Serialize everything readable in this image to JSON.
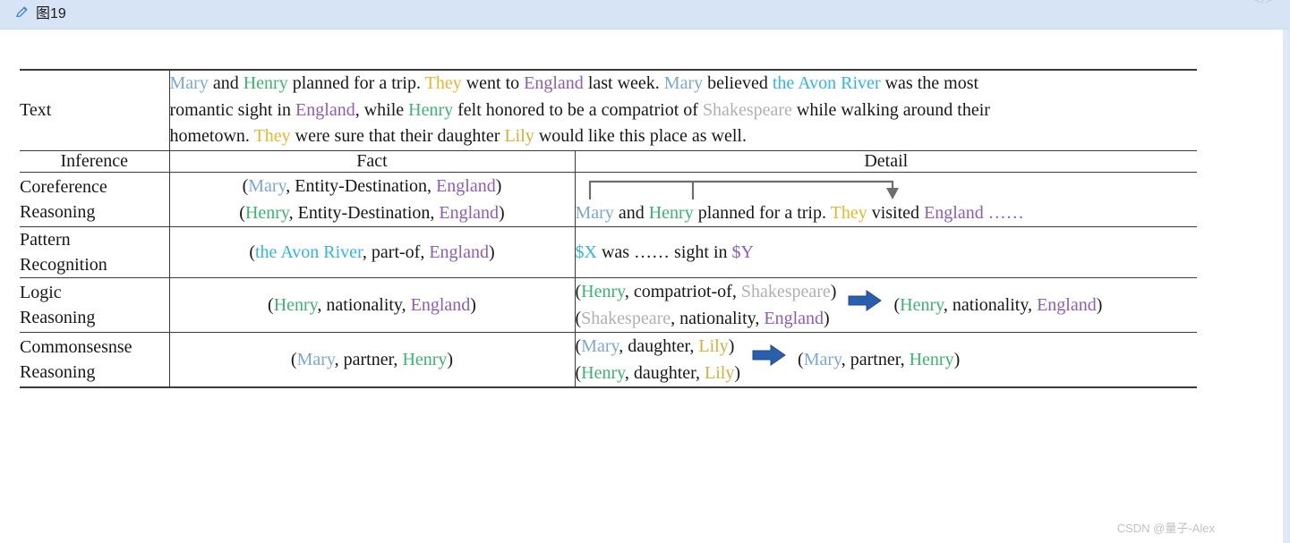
{
  "topbar": {
    "caption": "图19",
    "pencil_icon": "pencil-icon",
    "code_icon": "</>"
  },
  "watermark": "CSDN @量子-Alex",
  "colors": {
    "mary": "#7ba7d7",
    "henry": "#3cb371",
    "they": "#e8b62c",
    "england": "#8b5cb8",
    "avon_river": "#31b4e8",
    "shakespeare": "#b0b0b0",
    "lily": "#d6ae35",
    "arrow_blue": "#2a5fae",
    "bracket_gray": "#6e6e6e",
    "topbar_bg": "#d6e4f5"
  },
  "table": {
    "text_row": {
      "label": "Text",
      "line1": [
        {
          "t": "Mary",
          "c": "mary"
        },
        {
          "t": " and ",
          "c": "plain"
        },
        {
          "t": "Henry",
          "c": "henry"
        },
        {
          "t": " planned for a trip. ",
          "c": "plain"
        },
        {
          "t": "They",
          "c": "they"
        },
        {
          "t": " went to ",
          "c": "plain"
        },
        {
          "t": "England",
          "c": "england"
        },
        {
          "t": " last week. ",
          "c": "plain"
        },
        {
          "t": "Mary",
          "c": "mary"
        },
        {
          "t": " believed ",
          "c": "plain"
        },
        {
          "t": "the Avon River",
          "c": "avon"
        },
        {
          "t": " was the most",
          "c": "plain"
        }
      ],
      "line2": [
        {
          "t": "romantic sight in ",
          "c": "plain"
        },
        {
          "t": "England",
          "c": "england"
        },
        {
          "t": ", while ",
          "c": "plain"
        },
        {
          "t": "Henry",
          "c": "henry"
        },
        {
          "t": " felt honored to be a compatriot of ",
          "c": "plain"
        },
        {
          "t": "Shakespeare",
          "c": "shake"
        },
        {
          "t": " while walking around their",
          "c": "plain"
        }
      ],
      "line3": [
        {
          "t": "hometown. ",
          "c": "plain"
        },
        {
          "t": "They",
          "c": "they"
        },
        {
          "t": " were sure that their daughter ",
          "c": "plain"
        },
        {
          "t": "Lily",
          "c": "lily"
        },
        {
          "t": " would like this place as well.",
          "c": "plain"
        }
      ]
    },
    "headers": {
      "inference": "Inference",
      "fact": "Fact",
      "detail": "Detail"
    },
    "rows": [
      {
        "label_line1": "Coreference",
        "label_line2": "Reasoning",
        "fact_lines": [
          [
            {
              "t": "(",
              "c": "plain"
            },
            {
              "t": "Mary",
              "c": "mary"
            },
            {
              "t": ", Entity-Destination, ",
              "c": "plain"
            },
            {
              "t": "England",
              "c": "england"
            },
            {
              "t": ")",
              "c": "plain"
            }
          ],
          [
            {
              "t": "(",
              "c": "plain"
            },
            {
              "t": "Henry",
              "c": "henry"
            },
            {
              "t": ", Entity-Destination, ",
              "c": "plain"
            },
            {
              "t": "England",
              "c": "england"
            },
            {
              "t": ")",
              "c": "plain"
            }
          ]
        ],
        "detail_lines": [
          [
            {
              "t": "Mary",
              "c": "mary"
            },
            {
              "t": " and ",
              "c": "plain"
            },
            {
              "t": "Henry",
              "c": "henry"
            },
            {
              "t": " planned for a trip. ",
              "c": "plain"
            },
            {
              "t": "They",
              "c": "they"
            },
            {
              "t": " visited ",
              "c": "plain"
            },
            {
              "t": "England",
              "c": "england"
            },
            {
              "t": " ……",
              "c": "england"
            }
          ]
        ],
        "has_bracket": true
      },
      {
        "label_line1": "Pattern",
        "label_line2": "Recognition",
        "fact_lines": [
          [
            {
              "t": "(",
              "c": "plain"
            },
            {
              "t": "the Avon River",
              "c": "avon"
            },
            {
              "t": ", part-of, ",
              "c": "plain"
            },
            {
              "t": "England",
              "c": "england"
            },
            {
              "t": ")",
              "c": "plain"
            }
          ]
        ],
        "detail_lines": [
          [
            {
              "t": "$X",
              "c": "avon"
            },
            {
              "t": " was …… sight in ",
              "c": "plain"
            },
            {
              "t": "$Y",
              "c": "england"
            }
          ]
        ],
        "has_bracket": false
      },
      {
        "label_line1": "Logic",
        "label_line2": "Reasoning",
        "fact_lines": [
          [
            {
              "t": "(",
              "c": "plain"
            },
            {
              "t": "Henry",
              "c": "henry"
            },
            {
              "t": ", nationality, ",
              "c": "plain"
            },
            {
              "t": "England",
              "c": "england"
            },
            {
              "t": ")",
              "c": "plain"
            }
          ]
        ],
        "detail_premises": [
          [
            {
              "t": "(",
              "c": "plain"
            },
            {
              "t": "Henry",
              "c": "henry"
            },
            {
              "t": ", compatriot-of, ",
              "c": "plain"
            },
            {
              "t": "Shakespeare",
              "c": "shake"
            },
            {
              "t": ")",
              "c": "plain"
            }
          ],
          [
            {
              "t": "(",
              "c": "plain"
            },
            {
              "t": "Shakespeare",
              "c": "shake"
            },
            {
              "t": ",  nationality, ",
              "c": "plain"
            },
            {
              "t": "England",
              "c": "england"
            },
            {
              "t": ")",
              "c": "plain"
            }
          ]
        ],
        "detail_conclusion": [
          {
            "t": "(",
            "c": "plain"
          },
          {
            "t": "Henry",
            "c": "henry"
          },
          {
            "t": ",  nationality, ",
            "c": "plain"
          },
          {
            "t": "England",
            "c": "england"
          },
          {
            "t": ")",
            "c": "plain"
          }
        ],
        "has_bracket": false,
        "has_arrow": true
      },
      {
        "label_line1": "Commonsesnse",
        "label_line2": "Reasoning",
        "fact_lines": [
          [
            {
              "t": "(",
              "c": "plain"
            },
            {
              "t": "Mary",
              "c": "mary"
            },
            {
              "t": ", partner, ",
              "c": "plain"
            },
            {
              "t": "Henry",
              "c": "henry"
            },
            {
              "t": ")",
              "c": "plain"
            }
          ]
        ],
        "detail_premises": [
          [
            {
              "t": "(",
              "c": "plain"
            },
            {
              "t": "Mary",
              "c": "mary"
            },
            {
              "t": ", daughter, ",
              "c": "plain"
            },
            {
              "t": "Lily",
              "c": "lily"
            },
            {
              "t": ")",
              "c": "plain"
            }
          ],
          [
            {
              "t": "(",
              "c": "plain"
            },
            {
              "t": "Henry",
              "c": "henry"
            },
            {
              "t": ", daughter, ",
              "c": "plain"
            },
            {
              "t": "Lily",
              "c": "lily"
            },
            {
              "t": ")",
              "c": "plain"
            }
          ]
        ],
        "detail_conclusion": [
          {
            "t": "(",
            "c": "plain"
          },
          {
            "t": "Mary",
            "c": "mary"
          },
          {
            "t": ", partner, ",
            "c": "plain"
          },
          {
            "t": "Henry",
            "c": "henry"
          },
          {
            "t": ")",
            "c": "plain"
          }
        ],
        "has_bracket": false,
        "has_arrow": true
      }
    ]
  }
}
